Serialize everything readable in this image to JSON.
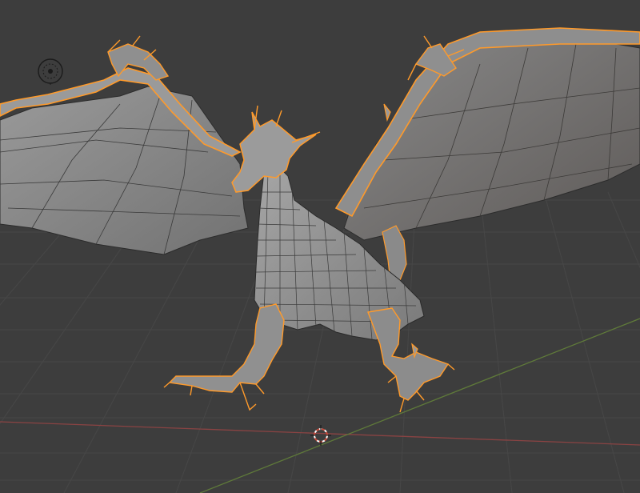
{
  "viewport": {
    "background": "#3d3d3d",
    "grid_color": "#474747",
    "grid_major_color": "#4e4e4e",
    "x_axis_color": "#8a4343",
    "y_axis_color": "#5f7a3a"
  },
  "object": {
    "name_icon": "dragon-mesh",
    "selected": true,
    "mesh_fill": "#8f8f8f",
    "mesh_shade": "#6c6c6c",
    "wire_color": "#2a2a2a",
    "selection_outline": "#ff9a2a"
  },
  "gizmos": {
    "light": "light-icon",
    "cursor": "3d-cursor-icon"
  }
}
